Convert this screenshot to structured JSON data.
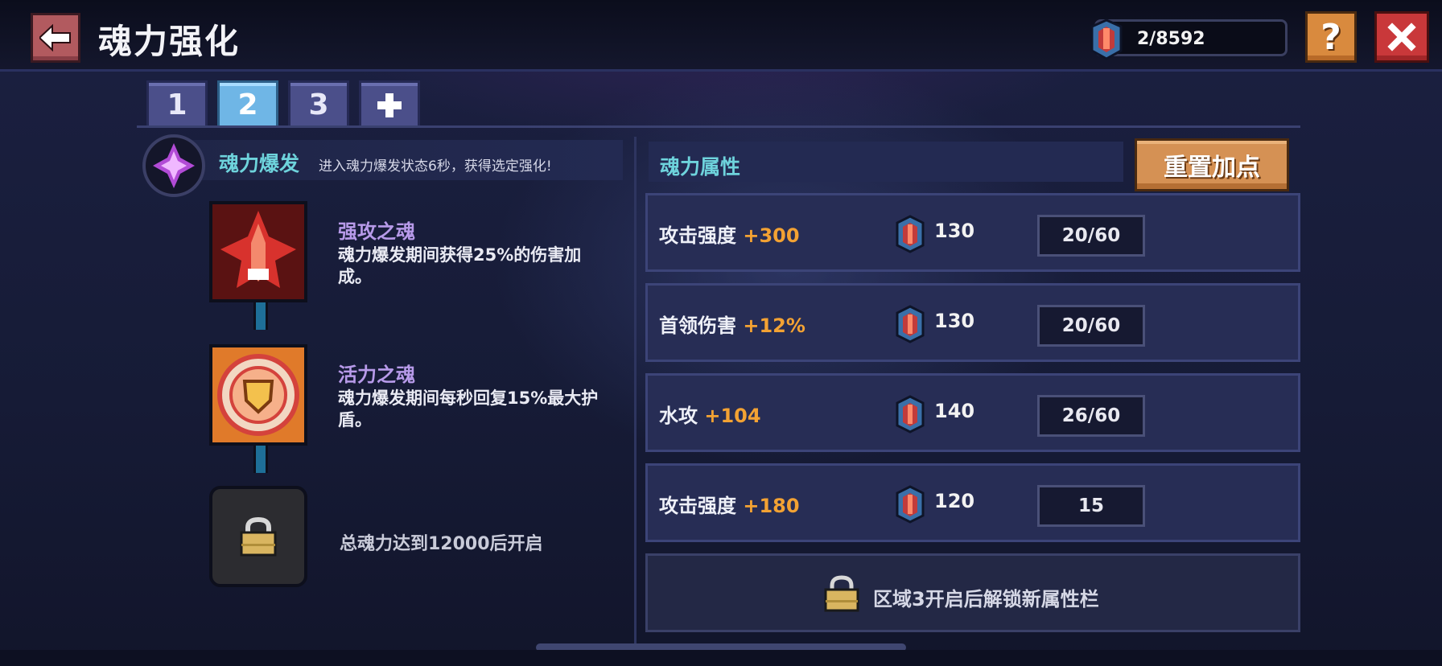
{
  "header": {
    "title": "魂力强化",
    "currency_value": "2/8592",
    "help_label": "?"
  },
  "tabs": [
    {
      "label": "1",
      "active": false
    },
    {
      "label": "2",
      "active": true
    },
    {
      "label": "3",
      "active": false
    },
    {
      "label": "+",
      "active": false
    }
  ],
  "burst": {
    "title": "魂力爆发",
    "description": "进入魂力爆发状态6秒，获得选定强化!"
  },
  "skills": [
    {
      "name": "强攻之魂",
      "description": "魂力爆发期间获得25%的伤害加成。",
      "icon": "red-ship-icon"
    },
    {
      "name": "活力之魂",
      "description": "魂力爆发期间每秒回复15%最大护盾。",
      "icon": "shield-orb-icon"
    }
  ],
  "locked_skill": {
    "text": "总魂力达到12000后开启"
  },
  "attributes": {
    "header": "魂力属性",
    "reset_label": "重置加点",
    "rows": [
      {
        "name": "攻击强度",
        "bonus": "+300",
        "cost": "130",
        "level": "20/60"
      },
      {
        "name": "首领伤害",
        "bonus": "+12%",
        "cost": "130",
        "level": "20/60"
      },
      {
        "name": "水攻",
        "bonus": "+104",
        "cost": "140",
        "level": "26/60"
      },
      {
        "name": "攻击强度",
        "bonus": "+180",
        "cost": "120",
        "level": "15"
      }
    ],
    "locked_row_text": "区域3开启后解锁新属性栏"
  },
  "colors": {
    "accent_teal": "#6ed3dc",
    "bonus_orange": "#f3a233",
    "skill_purple": "#b79ae9",
    "reset_orange": "#d59154",
    "close_red": "#c9383a"
  }
}
